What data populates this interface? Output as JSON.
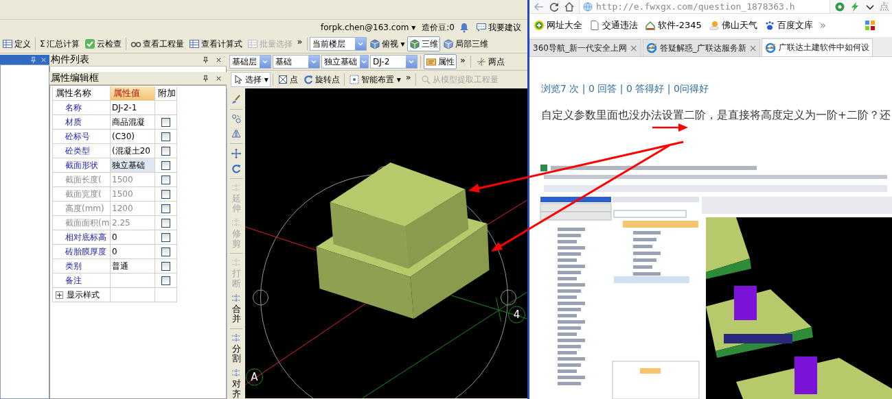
{
  "app": {
    "user_bar": {
      "account": "forpk.chen@163.com",
      "account_caret": "▾",
      "beans": "造价豆:0",
      "feedback": "我要建议"
    },
    "main_toolbar": [
      {
        "label": "定义",
        "disabled": false
      },
      {
        "glyph": "Σ",
        "label": "汇总计算",
        "disabled": false
      },
      {
        "label": "云检查",
        "disabled": false
      },
      {
        "label": "查看工程量",
        "disabled": false
      },
      {
        "label": "查看计算式",
        "disabled": false
      },
      {
        "label": "批量选择",
        "disabled": true
      }
    ],
    "main_toolbar_overflow": "»",
    "view_toolbar": {
      "floor": "当前楼层",
      "buttons": [
        {
          "label": "俯视",
          "caret": "▾",
          "pressed": false
        },
        {
          "label": "三维",
          "pressed": true
        },
        {
          "label": "局部三维",
          "pressed": false
        }
      ]
    },
    "component_list": {
      "title": "构件列表"
    },
    "property_editor": {
      "title": "属性编辑框",
      "columns": [
        "属性名称",
        "属性值",
        "附加"
      ],
      "rows": [
        {
          "kind": "text",
          "name": "名称",
          "value": "DJ-2-1",
          "locked": false,
          "selected": false
        },
        {
          "kind": "option",
          "name": "材质",
          "value": "商品混凝",
          "locked": false,
          "selected": false,
          "checked": false
        },
        {
          "kind": "option",
          "name": "砼标号",
          "value": "(C30)",
          "locked": false,
          "selected": false,
          "checked": false
        },
        {
          "kind": "option",
          "name": "砼类型",
          "value": "(混凝土20",
          "locked": false,
          "selected": false,
          "checked": false
        },
        {
          "kind": "option",
          "name": "截面形状",
          "value": "独立基础",
          "locked": false,
          "selected": true,
          "checked": false
        },
        {
          "kind": "option",
          "name": "截面长度(",
          "value": "1500",
          "locked": true,
          "selected": false,
          "checked": false
        },
        {
          "kind": "option",
          "name": "截面宽度(",
          "value": "1500",
          "locked": true,
          "selected": false,
          "checked": false
        },
        {
          "kind": "option",
          "name": "高度(mm)",
          "value": "1200",
          "locked": true,
          "selected": false,
          "checked": false
        },
        {
          "kind": "option",
          "name": "截面面积(m",
          "value": "2.25",
          "locked": true,
          "selected": false,
          "checked": false
        },
        {
          "kind": "option",
          "name": "相对底标高",
          "value": "0",
          "locked": false,
          "selected": false,
          "checked": false
        },
        {
          "kind": "option",
          "name": "砖胎膜厚度",
          "value": "0",
          "locked": false,
          "selected": false,
          "checked": false
        },
        {
          "kind": "option",
          "name": "类别",
          "value": "普通",
          "locked": false,
          "selected": false,
          "checked": false
        },
        {
          "kind": "option",
          "name": "备注",
          "locked": false,
          "selected": false,
          "checked": false
        },
        {
          "kind": "group",
          "expander": "+",
          "name": "显示样式"
        }
      ]
    },
    "filter_bar": {
      "selects": [
        "基础层",
        "基础",
        "独立基础",
        "DJ-2"
      ],
      "property_button": {
        "label": "属性",
        "pressed": true
      },
      "overflow": "»",
      "two_point": "两点"
    },
    "draw_bar": {
      "tools": [
        {
          "label": "选择",
          "caret": "▾",
          "disabled": false
        },
        {
          "label": "点",
          "disabled": false
        },
        {
          "label": "旋转点",
          "disabled": false
        },
        {
          "label": "智能布置",
          "caret": "▾",
          "disabled": false
        }
      ],
      "overflow": "»",
      "extract": {
        "label": "从模型提取工程量",
        "disabled": true
      }
    },
    "edit_tools": [
      {
        "label": "延伸",
        "disabled": true
      },
      {
        "label": "修剪",
        "disabled": true
      },
      {
        "label": "打断",
        "disabled": true
      },
      {
        "label": "合并",
        "disabled": false
      },
      {
        "label": "分割",
        "disabled": false
      },
      {
        "label": "对齐",
        "disabled": false
      }
    ],
    "viewport": {
      "axis_labels": [
        "A",
        "4"
      ]
    }
  },
  "browser": {
    "address": "http://e.fwxgx.com/question_1878363.h",
    "search_hint": "点",
    "bookmarks": [
      "网址大全",
      "交通违法",
      "软件-2345",
      "佛山天气",
      "百度文库"
    ],
    "bookmarks_overflow": "»",
    "tabs": [
      {
        "title": "360导航_新一代安全上网",
        "close": "×",
        "selected": false
      },
      {
        "title": "答疑解惑_广联达服务新",
        "close": "×",
        "selected": false
      },
      {
        "title": "广联达土建软件中如何设",
        "selected": true
      }
    ],
    "stats": "浏览7 次 | 0 回答 | 0 答得好 | 0问得好",
    "question": "自定义参数里面也没办法设置二阶，是直接将高度定义为一阶+二阶？还"
  }
}
